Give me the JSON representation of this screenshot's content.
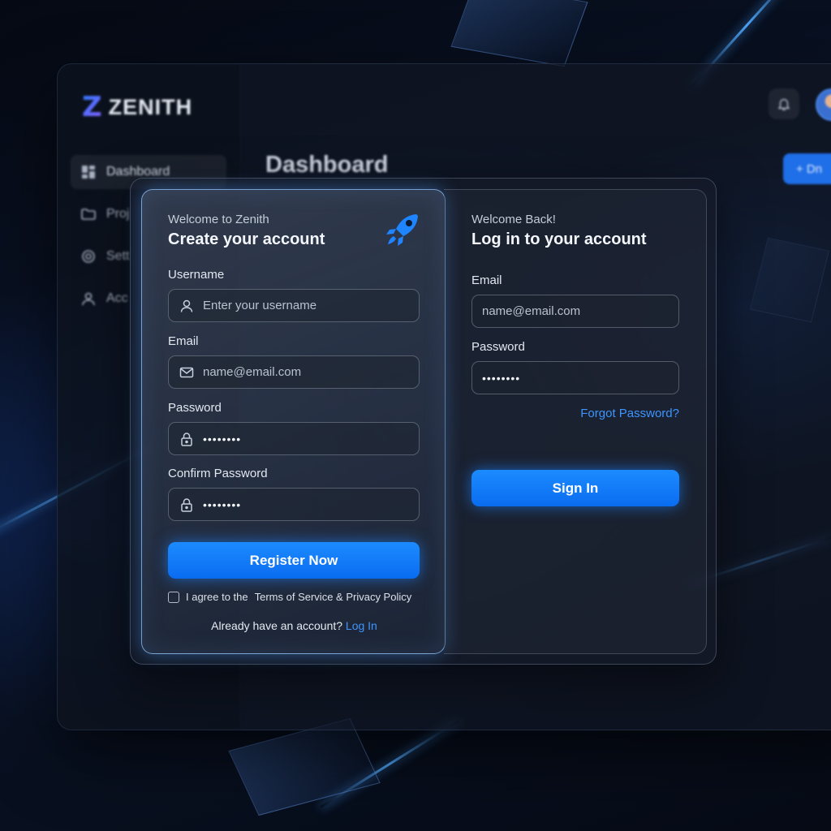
{
  "brand": {
    "logo_mark": "Z",
    "name": "ZENITH"
  },
  "dashboard": {
    "title": "Dashboard",
    "nav": [
      {
        "label": "Dashboard",
        "icon": "dashboard-icon",
        "active": true
      },
      {
        "label": "Proj",
        "icon": "folder-icon"
      },
      {
        "label": "Sett",
        "icon": "gear-icon"
      },
      {
        "label": "Acc",
        "icon": "user-icon"
      }
    ],
    "new_button_label": "+ Dn"
  },
  "register": {
    "eyebrow": "Welcome to Zenith",
    "heading": "Create your account",
    "username_label": "Username",
    "username_placeholder": "Enter your username",
    "email_label": "Email",
    "email_placeholder": "name@email.com",
    "password_label": "Password",
    "password_value": "••••••••",
    "confirm_label": "Confirm Password",
    "confirm_value": "••••••••",
    "submit_label": "Register Now",
    "agree_prefix": "I agree to the",
    "terms_label": "Terms of Service & Privacy Policy",
    "footer_prefix": "Already have an account?",
    "footer_link": "Log In"
  },
  "login": {
    "eyebrow": "Welcome Back!",
    "heading": "Log in to your account",
    "email_label": "Email",
    "email_placeholder": "name@email.com",
    "password_label": "Password",
    "password_value": "••••••••",
    "forgot_label": "Forgot Password?",
    "submit_label": "Sign In"
  },
  "colors": {
    "accent": "#1a82ff",
    "link": "#3e95ff",
    "background": "#070c18"
  }
}
